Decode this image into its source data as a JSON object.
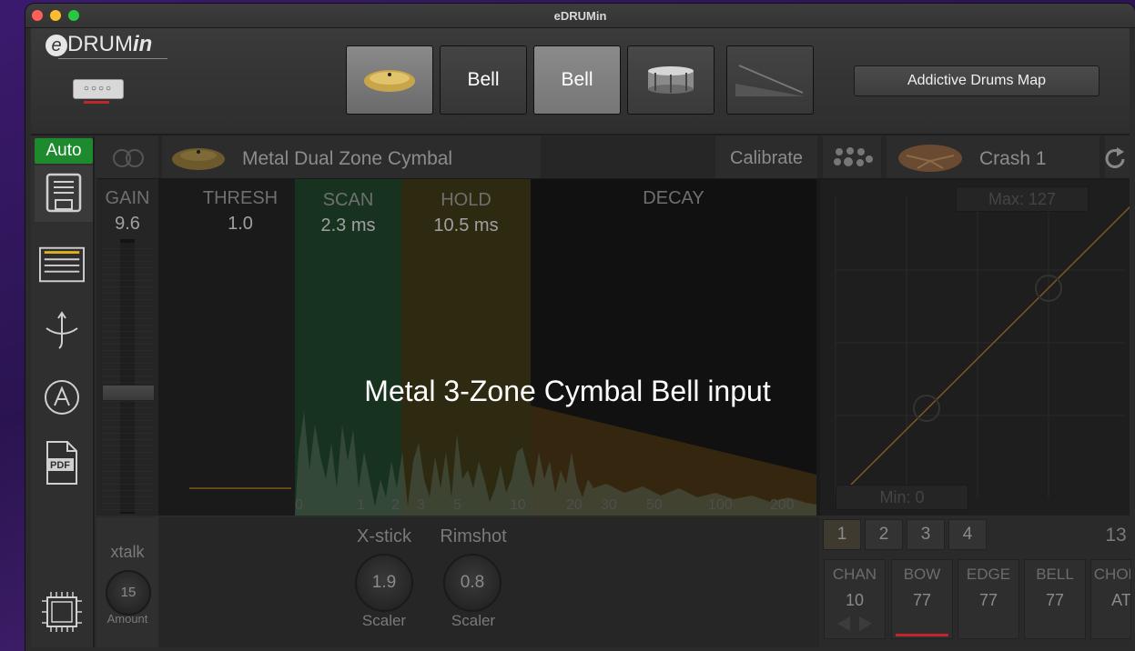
{
  "window": {
    "title": "eDRUMin"
  },
  "logo": {
    "e": "e",
    "drum": "DRUM",
    "in": "in",
    "device": "○○○○"
  },
  "zones": {
    "bell_a": "Bell",
    "bell_b": "Bell"
  },
  "map_button": "Addictive Drums Map",
  "sidebar": {
    "auto": "Auto"
  },
  "strip": {
    "pad_type": "Metal Dual Zone Cymbal",
    "calibrate": "Calibrate",
    "instrument": "Crash 1"
  },
  "params": {
    "gain_label": "GAIN",
    "gain_value": "9.6",
    "thresh_label": "THRESH",
    "thresh_value": "1.0",
    "scan_label": "SCAN",
    "scan_value": "2.3 ms",
    "hold_label": "HOLD",
    "hold_value": "10.5 ms",
    "decay_label": "DECAY"
  },
  "axis_ticks": [
    "0",
    "1",
    "2",
    "3",
    "5",
    "10",
    "20",
    "30",
    "50",
    "100",
    "200"
  ],
  "curve": {
    "max": "Max: 127",
    "min": "Min: 0"
  },
  "overlay": "Metal 3-Zone Cymbal Bell input",
  "bottom": {
    "xtalk": "xtalk",
    "amount_value": "15",
    "amount_label": "Amount",
    "xstick_label": "X-stick",
    "xstick_value": "1.9",
    "xstick_sub": "Scaler",
    "rimshot_label": "Rimshot",
    "rimshot_value": "0.8",
    "rimshot_sub": "Scaler",
    "tabs": [
      "1",
      "2",
      "3",
      "4"
    ],
    "count": "13",
    "mix": [
      {
        "label": "CHAN",
        "value": "10"
      },
      {
        "label": "BOW",
        "value": "77"
      },
      {
        "label": "EDGE",
        "value": "77"
      },
      {
        "label": "BELL",
        "value": "77"
      },
      {
        "label": "CHOKE",
        "value": "AT"
      }
    ]
  },
  "colors": {
    "scan": "#17331f",
    "hold": "#2e2a12",
    "auto": "#1d8a2e",
    "accent_red": "#c0272d"
  }
}
